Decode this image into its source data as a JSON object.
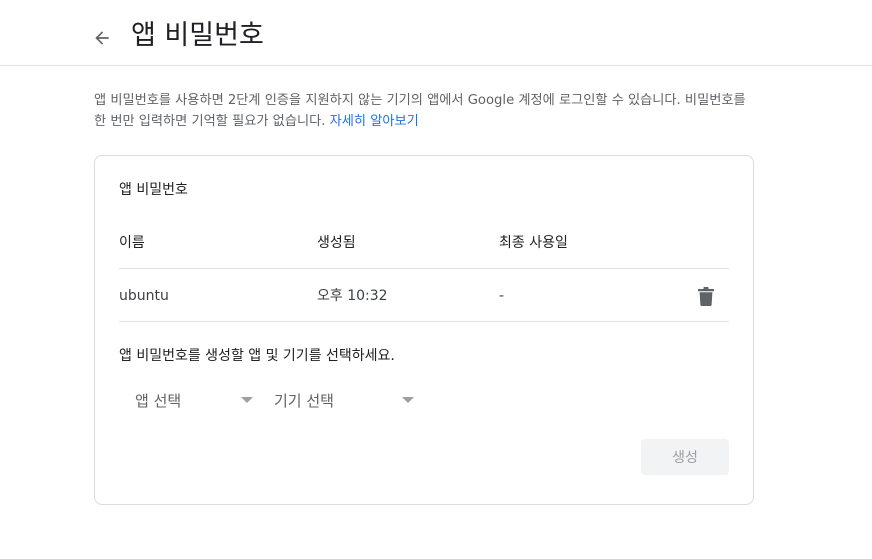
{
  "header": {
    "title": "앱 비밀번호"
  },
  "description": {
    "text": "앱 비밀번호를 사용하면 2단계 인증을 지원하지 않는 기기의 앱에서 Google 계정에 로그인할 수 있습니다. 비밀번호를 한 번만 입력하면 기억할 필요가 없습니다.",
    "link_text": "자세히 알아보기"
  },
  "card": {
    "title": "앱 비밀번호",
    "columns": [
      "이름",
      "생성됨",
      "최종 사용일"
    ],
    "rows": [
      {
        "name": "ubuntu",
        "created": "오후 10:32",
        "last_used": "-"
      }
    ],
    "select_prompt": "앱 비밀번호를 생성할 앱 및 기기를 선택하세요.",
    "app_select": "앱 선택",
    "device_select": "기기 선택",
    "generate_label": "생성"
  },
  "colors": {
    "link": "#1a73e8",
    "border": "#dadce0",
    "disabled_button_bg": "#f1f3f4"
  }
}
